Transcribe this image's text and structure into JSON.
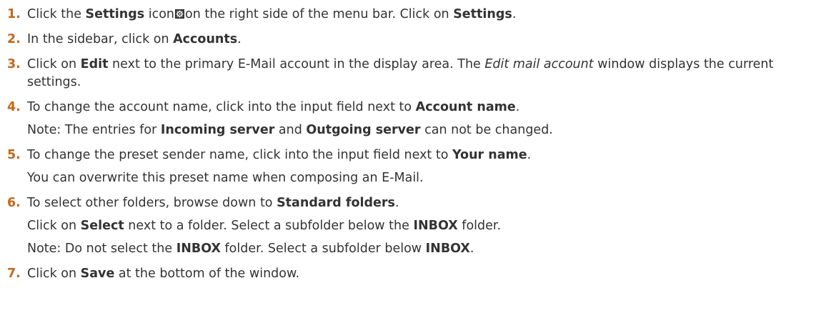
{
  "steps": [
    {
      "number": "1.",
      "lines": [
        {
          "segments": [
            {
              "text": "Click the ",
              "style": "normal"
            },
            {
              "text": "Settings",
              "style": "bold"
            },
            {
              "text": " icon",
              "style": "normal"
            },
            {
              "icon": "gear-icon"
            },
            {
              "text": "on the right side of the menu bar. Click on ",
              "style": "normal"
            },
            {
              "text": "Settings",
              "style": "bold"
            },
            {
              "text": ".",
              "style": "normal"
            }
          ]
        }
      ]
    },
    {
      "number": "2.",
      "lines": [
        {
          "segments": [
            {
              "text": "In the sidebar, click on ",
              "style": "normal"
            },
            {
              "text": "Accounts",
              "style": "bold"
            },
            {
              "text": ".",
              "style": "normal"
            }
          ]
        }
      ]
    },
    {
      "number": "3.",
      "lines": [
        {
          "segments": [
            {
              "text": "Click on ",
              "style": "normal"
            },
            {
              "text": "Edit",
              "style": "bold"
            },
            {
              "text": " next to the primary E-Mail account in the display area. The ",
              "style": "normal"
            },
            {
              "text": "Edit mail account",
              "style": "italic"
            },
            {
              "text": " window displays the current settings.",
              "style": "normal"
            }
          ]
        }
      ]
    },
    {
      "number": "4.",
      "lines": [
        {
          "segments": [
            {
              "text": "To change the account name, click into the input field next to ",
              "style": "normal"
            },
            {
              "text": "Account name",
              "style": "bold"
            },
            {
              "text": ".",
              "style": "normal"
            }
          ]
        },
        {
          "segments": [
            {
              "text": "Note: The entries for ",
              "style": "normal"
            },
            {
              "text": "Incoming server",
              "style": "bold"
            },
            {
              "text": " and ",
              "style": "normal"
            },
            {
              "text": "Outgoing server",
              "style": "bold"
            },
            {
              "text": " can not be changed.",
              "style": "normal"
            }
          ]
        }
      ]
    },
    {
      "number": "5.",
      "lines": [
        {
          "segments": [
            {
              "text": "To change the preset sender name, click into the input field next to ",
              "style": "normal"
            },
            {
              "text": "Your name",
              "style": "bold"
            },
            {
              "text": ".",
              "style": "normal"
            }
          ]
        },
        {
          "segments": [
            {
              "text": "You can overwrite this preset name when composing an E-Mail.",
              "style": "normal"
            }
          ]
        }
      ]
    },
    {
      "number": "6.",
      "lines": [
        {
          "segments": [
            {
              "text": "To select other folders, browse down to ",
              "style": "normal"
            },
            {
              "text": "Standard folders",
              "style": "bold"
            },
            {
              "text": ".",
              "style": "normal"
            }
          ]
        },
        {
          "segments": [
            {
              "text": "Click on ",
              "style": "normal"
            },
            {
              "text": "Select",
              "style": "bold"
            },
            {
              "text": " next to a folder. Select a subfolder below the ",
              "style": "normal"
            },
            {
              "text": "INBOX",
              "style": "bold"
            },
            {
              "text": " folder.",
              "style": "normal"
            }
          ]
        },
        {
          "segments": [
            {
              "text": "Note: Do not select the ",
              "style": "normal"
            },
            {
              "text": "INBOX",
              "style": "bold"
            },
            {
              "text": " folder. Select a subfolder below ",
              "style": "normal"
            },
            {
              "text": "INBOX",
              "style": "bold"
            },
            {
              "text": ".",
              "style": "normal"
            }
          ]
        }
      ]
    },
    {
      "number": "7.",
      "lines": [
        {
          "segments": [
            {
              "text": "Click on ",
              "style": "normal"
            },
            {
              "text": "Save",
              "style": "bold"
            },
            {
              "text": " at the bottom of the window.",
              "style": "normal"
            }
          ]
        }
      ]
    }
  ],
  "colors": {
    "step_number": "#c7671a",
    "text": "#333333"
  }
}
